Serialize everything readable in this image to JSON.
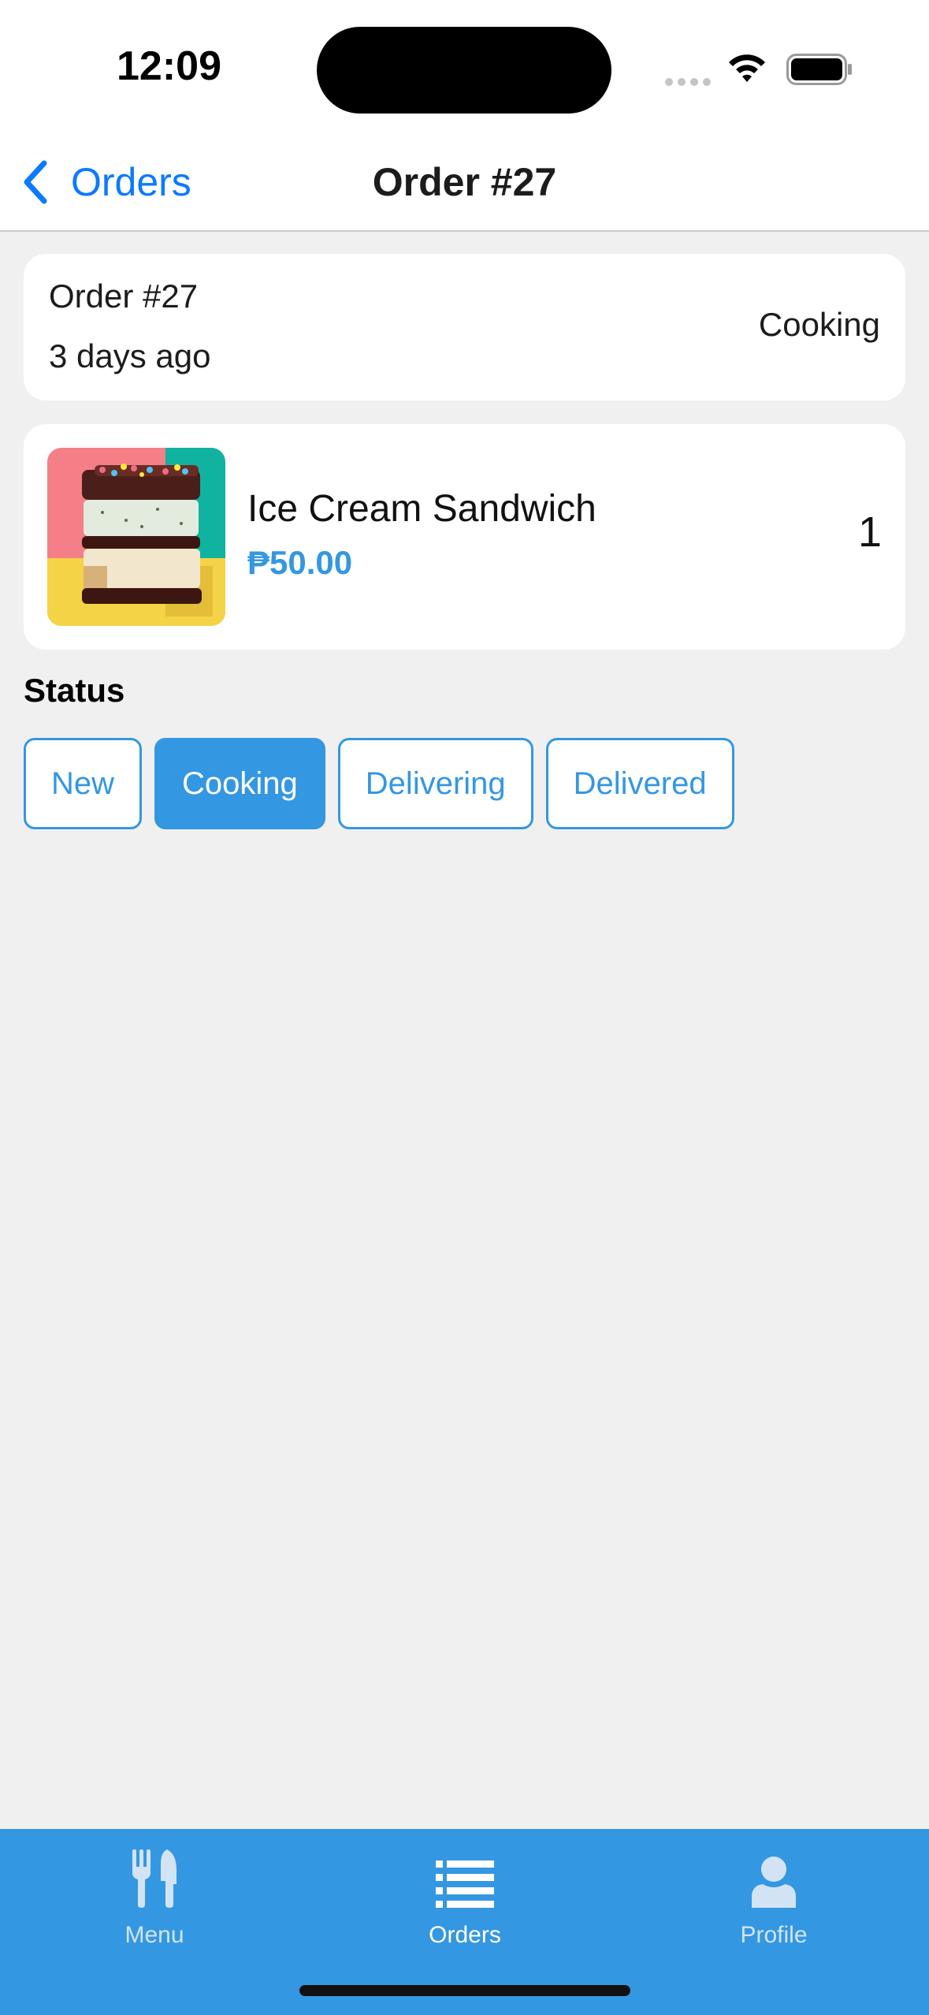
{
  "status_bar": {
    "time": "12:09"
  },
  "nav": {
    "back_label": "Orders",
    "title": "Order #27"
  },
  "order_summary": {
    "label": "Order #27",
    "time_ago": "3 days ago",
    "status": "Cooking"
  },
  "items": [
    {
      "name": "Ice Cream Sandwich",
      "price": "₱50.00",
      "quantity": "1",
      "image": "ice-cream-sandwich-photo"
    }
  ],
  "status_section": {
    "heading": "Status",
    "options": [
      {
        "label": "New",
        "selected": false
      },
      {
        "label": "Cooking",
        "selected": true
      },
      {
        "label": "Delivering",
        "selected": false
      },
      {
        "label": "Delivered",
        "selected": false
      }
    ]
  },
  "tab_bar": {
    "tabs": [
      {
        "label": "Menu",
        "icon": "fork-knife-icon",
        "active": false
      },
      {
        "label": "Orders",
        "icon": "list-icon",
        "active": true
      },
      {
        "label": "Profile",
        "icon": "person-icon",
        "active": false
      }
    ]
  },
  "colors": {
    "accent": "#3497e1",
    "link": "#0a7aff",
    "background": "#f0f0f0"
  }
}
